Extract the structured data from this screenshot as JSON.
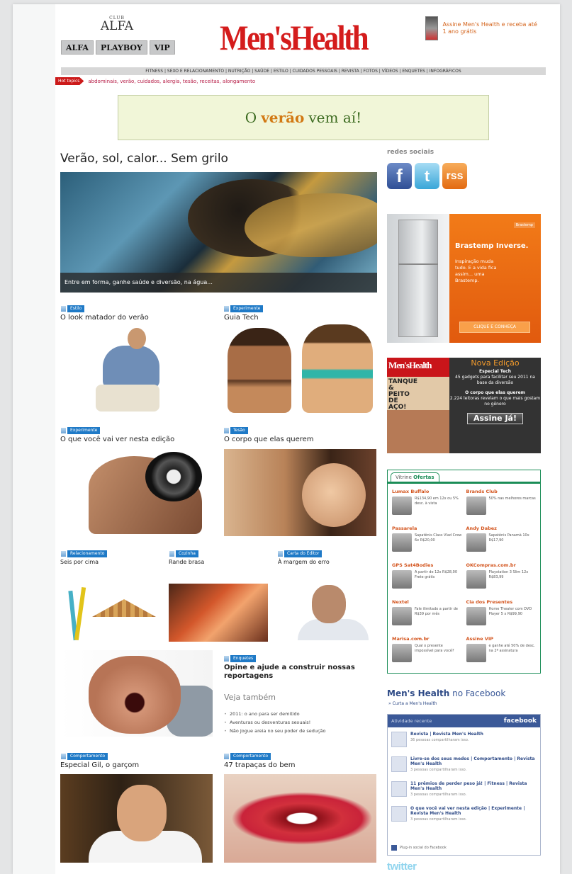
{
  "header": {
    "club_small": "CLUB",
    "club_name": "ALFA",
    "brand_tabs": [
      "ALFA",
      "PLAYBOY",
      "VIP"
    ],
    "logo": "Men'sHealth",
    "promo_text": "Assine Men's Health e receba até 1 ano grátis"
  },
  "nav": {
    "items": "FITNESS | SEXO E RELACIONAMENTO | NUTRIÇÃO | SAÚDE | ESTILO | CUIDADOS PESSOAIS | REVISTA | FOTOS | VÍDEOS | ENQUETES | INFOGRÁFICOS",
    "hot_label": "Hot topics",
    "hot_text": "abdominais, verão, cuidados, alergia, tesão, receitas, alongamento"
  },
  "banner": {
    "part1": "O",
    "accent": "verão",
    "part2": "vem aí!"
  },
  "feature": {
    "headline": "Verão, sol, calor... Sem grilo",
    "caption": "Entre em forma, ganhe saúde e diversão, na água..."
  },
  "cards": {
    "c1": {
      "tag": "Estilo",
      "title": "O look matador do verão"
    },
    "c2": {
      "tag": "Experimente",
      "title": "Guia Tech"
    },
    "c3": {
      "tag": "Experimente",
      "title": "O que você vai ver nesta edição"
    },
    "c4": {
      "tag": "Tesão",
      "title": "O corpo que elas querem"
    },
    "c5": {
      "tag": "Relacionamento",
      "title": "Seis por cima"
    },
    "c6": {
      "tag": "Cozinha",
      "title": "Rande brasa"
    },
    "c7": {
      "tag": "Carta do Editor",
      "title": "À margem do erro"
    },
    "c8": {
      "tag": "Comportamento",
      "title": "Especial Gil, o garçom"
    },
    "c9": {
      "tag": "Comportamento",
      "title": "47 trapaças do bem"
    }
  },
  "poll": {
    "tag": "Enquetes",
    "title": "Opine e ajude a construir nossas reportagens",
    "see_also": "Veja também",
    "links": [
      "2011: o ano para ser demitido",
      "Aventuras ou desventuras sexuais!",
      "Não Jogue areia no seu poder de sedução"
    ]
  },
  "sidebar": {
    "social_title": "redes sociais",
    "social": [
      "f",
      "t",
      "rss"
    ],
    "brastemp": {
      "mini": "Brastemp",
      "heading": "Brastemp Inverse.",
      "body": "Inspiração muda tudo. E a vida fica assim... uma Brastemp.",
      "button": "CLIQUE E CONHEÇA"
    },
    "mag": {
      "cover_title": "Men'sHealth",
      "cover_text": "TANQUE & PEITO DE AÇO!",
      "new_edition": "Nova Edição",
      "special": "Especial Tech",
      "line1": "45 gadgets para facilitar seu 2011 na base da diversão",
      "line2": "O corpo que elas querem",
      "line3": "2.224 leitoras revelam o que mais gostam no gênero",
      "button": "Assine Já!"
    },
    "vitrine": {
      "tab_label": "Vitrine",
      "tab_bold": "Ofertas",
      "offers": [
        {
          "store": "Lumax Buffalo",
          "desc": "R$134,90 em 12x ou 5% desc. à vista"
        },
        {
          "store": "Brands Club",
          "desc": "50% nas melhores marcas"
        },
        {
          "store": "Passarela",
          "desc": "Sapatênis Class Vlad Crew 6x R$20,00"
        },
        {
          "store": "Andy Dabez",
          "desc": "Sapatênis Panamà 10x R$17,90"
        },
        {
          "store": "GPS Sat4Bodies",
          "desc": "A partir de 12x R$28,00 Frete grátis"
        },
        {
          "store": "OKCompras.com.br",
          "desc": "Playstation 3 Slim 12x R$83,99"
        },
        {
          "store": "Nextel",
          "desc": "Fale ilimitado a partir de R$39 por mês"
        },
        {
          "store": "Cia dos Presentes",
          "desc": "Home Theater com DVD Player 5 x R$99,90"
        },
        {
          "store": "Marisa.com.br",
          "desc": "Qual o presente impossível para você?"
        },
        {
          "store": "Assine VIP",
          "desc": "e ganhe até 50% de desc. na 2ª assinatura"
        }
      ]
    },
    "facebook": {
      "title_bold": "Men's Health",
      "title_rest": "no Facebook",
      "sub": "» Curta a Men's Health",
      "head_left": "Atividade recente",
      "head_right": "facebook",
      "items": [
        {
          "title": "Revista | Revista Men's Health",
          "sub": "36 pessoas compartilharam isso."
        },
        {
          "title": "Livre-se dos seus medos | Comportamento | Revista Men's Health",
          "sub": "3 pessoas compartilharam isso."
        },
        {
          "title": "11 prêmios de perder peso já! | Fitness | Revista Men's Health",
          "sub": "3 pessoas compartilharam isso."
        },
        {
          "title": "O que você vai ver nesta edição | Experimente | Revista Men's Health",
          "sub": "3 pessoas compartilharam isso."
        }
      ],
      "foot": "Plug-in social do Facebook"
    },
    "twitter": "twitter"
  }
}
